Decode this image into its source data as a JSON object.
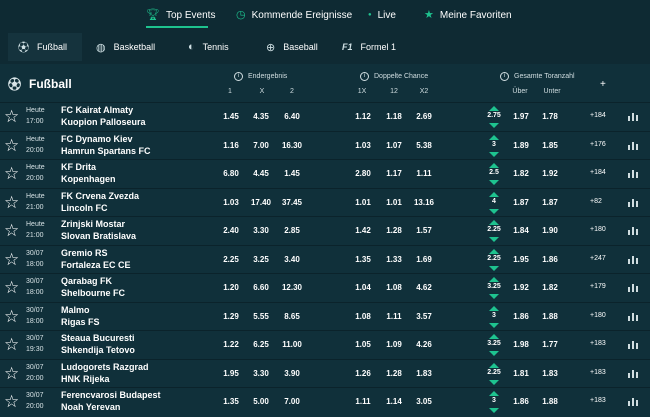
{
  "topnav": [
    {
      "label": "Top Events",
      "icon": "trophy-icon",
      "active": true
    },
    {
      "label": "Kommende Ereignisse",
      "icon": "clock-icon",
      "active": false
    },
    {
      "label": "Live",
      "icon": "live-dot-icon",
      "active": false
    },
    {
      "label": "Meine Favoriten",
      "icon": "star-icon",
      "active": false
    }
  ],
  "sport_tabs": [
    {
      "label": "Fußball",
      "icon": "soccer-ball-icon",
      "active": true
    },
    {
      "label": "Basketball",
      "icon": "basketball-icon",
      "active": false
    },
    {
      "label": "Tennis",
      "icon": "tennis-ball-icon",
      "active": false
    },
    {
      "label": "Baseball",
      "icon": "baseball-icon",
      "active": false
    },
    {
      "label": "Formel 1",
      "icon": "f1-logo-icon",
      "active": false
    }
  ],
  "panel": {
    "sport_title": "Fußball",
    "markets": {
      "endergebnis": {
        "label": "Endergebnis",
        "cols": [
          "1",
          "X",
          "2"
        ]
      },
      "doppelte_chance": {
        "label": "Doppelte Chance",
        "cols": [
          "1X",
          "12",
          "X2"
        ]
      },
      "gesamte_toranzahl": {
        "label": "Gesamte Toranzahl",
        "cols": [
          "Über",
          "Unter"
        ]
      }
    },
    "plus_label": "+"
  },
  "events": [
    {
      "date": "Heute",
      "time": "17:00",
      "home": "FC Kairat Almaty",
      "away": "Kuopion Palloseura",
      "res": [
        "1.45",
        "4.35",
        "6.40"
      ],
      "dc": [
        "1.12",
        "1.18",
        "2.69"
      ],
      "line": "2.75",
      "ou": [
        "1.97",
        "1.78"
      ],
      "more": "+184"
    },
    {
      "date": "Heute",
      "time": "20:00",
      "home": "FC Dynamo Kiev",
      "away": "Hamrun Spartans FC",
      "res": [
        "1.16",
        "7.00",
        "16.30"
      ],
      "dc": [
        "1.03",
        "1.07",
        "5.38"
      ],
      "line": "3",
      "ou": [
        "1.89",
        "1.85"
      ],
      "more": "+176"
    },
    {
      "date": "Heute",
      "time": "20:00",
      "home": "KF Drita",
      "away": "Kopenhagen",
      "res": [
        "6.80",
        "4.45",
        "1.45"
      ],
      "dc": [
        "2.80",
        "1.17",
        "1.11"
      ],
      "line": "2.5",
      "ou": [
        "1.82",
        "1.92"
      ],
      "more": "+184"
    },
    {
      "date": "Heute",
      "time": "21:00",
      "home": "FK Crvena Zvezda",
      "away": "Lincoln FC",
      "res": [
        "1.03",
        "17.40",
        "37.45"
      ],
      "dc": [
        "1.01",
        "1.01",
        "13.16"
      ],
      "line": "4",
      "ou": [
        "1.87",
        "1.87"
      ],
      "more": "+82"
    },
    {
      "date": "Heute",
      "time": "21:00",
      "home": "Zrinjski Mostar",
      "away": "Slovan Bratislava",
      "res": [
        "2.40",
        "3.30",
        "2.85"
      ],
      "dc": [
        "1.42",
        "1.28",
        "1.57"
      ],
      "line": "2.25",
      "ou": [
        "1.84",
        "1.90"
      ],
      "more": "+180"
    },
    {
      "date": "30/07",
      "time": "18:00",
      "home": "Gremio RS",
      "away": "Fortaleza EC CE",
      "res": [
        "2.25",
        "3.25",
        "3.40"
      ],
      "dc": [
        "1.35",
        "1.33",
        "1.69"
      ],
      "line": "2.25",
      "ou": [
        "1.95",
        "1.86"
      ],
      "more": "+247"
    },
    {
      "date": "30/07",
      "time": "18:00",
      "home": "Qarabag FK",
      "away": "Shelbourne FC",
      "res": [
        "1.20",
        "6.60",
        "12.30"
      ],
      "dc": [
        "1.04",
        "1.08",
        "4.62"
      ],
      "line": "3.25",
      "ou": [
        "1.92",
        "1.82"
      ],
      "more": "+179"
    },
    {
      "date": "30/07",
      "time": "18:00",
      "home": "Malmo",
      "away": "Rigas FS",
      "res": [
        "1.29",
        "5.55",
        "8.65"
      ],
      "dc": [
        "1.08",
        "1.11",
        "3.57"
      ],
      "line": "3",
      "ou": [
        "1.86",
        "1.88"
      ],
      "more": "+180"
    },
    {
      "date": "30/07",
      "time": "19:30",
      "home": "Steaua Bucuresti",
      "away": "Shkendija Tetovo",
      "res": [
        "1.22",
        "6.25",
        "11.00"
      ],
      "dc": [
        "1.05",
        "1.09",
        "4.26"
      ],
      "line": "3.25",
      "ou": [
        "1.98",
        "1.77"
      ],
      "more": "+183"
    },
    {
      "date": "30/07",
      "time": "20:00",
      "home": "Ludogorets Razgrad",
      "away": "HNK Rijeka",
      "res": [
        "1.95",
        "3.30",
        "3.90"
      ],
      "dc": [
        "1.26",
        "1.28",
        "1.83"
      ],
      "line": "2.25",
      "ou": [
        "1.81",
        "1.83"
      ],
      "more": "+183"
    },
    {
      "date": "30/07",
      "time": "20:00",
      "home": "Ferencvarosi Budapest",
      "away": "Noah Yerevan",
      "res": [
        "1.35",
        "5.00",
        "7.00"
      ],
      "dc": [
        "1.11",
        "1.14",
        "3.05"
      ],
      "line": "3",
      "ou": [
        "1.86",
        "1.88"
      ],
      "more": "+183"
    }
  ],
  "colors": {
    "accent": "#1ec38f",
    "bg": "#0f2a33",
    "panel": "#10303a"
  }
}
